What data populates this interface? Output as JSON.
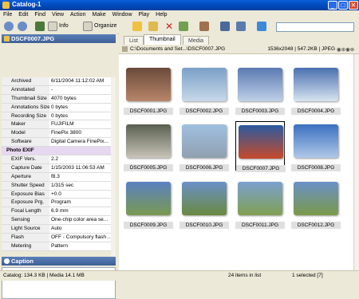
{
  "window": {
    "title": "Catalog-1",
    "min": "_",
    "max": "□",
    "close": "✕"
  },
  "menu": [
    "File",
    "Edit",
    "Find",
    "View",
    "Action",
    "Make",
    "Window",
    "Play",
    "Help"
  ],
  "toolbar": {
    "info_label": "Info",
    "organize_label": "Organize",
    "search_placeholder": ""
  },
  "left": {
    "file_header": "DSCF0007.JPG",
    "properties": [
      {
        "k": "Archived",
        "v": "6/11/2004 11:12:02 AM"
      },
      {
        "k": "Annotated",
        "v": "-"
      },
      {
        "k": "Thumbnail Size",
        "v": "4070 bytes"
      },
      {
        "k": "Annotations Size",
        "v": "0 bytes"
      },
      {
        "k": "Recording Size",
        "v": "0 bytes"
      },
      {
        "k": "Maker",
        "v": "FUJIFILM"
      },
      {
        "k": "Model",
        "v": "FinePix 3800"
      },
      {
        "k": "Software",
        "v": "Digital Camera FinePix..."
      }
    ],
    "exif_header": "Photo EXIF",
    "exif": [
      {
        "k": "EXIF Vers.",
        "v": "2.2"
      },
      {
        "k": "Capture Date",
        "v": "1/15/2003 11:06:53 AM"
      },
      {
        "k": "Aperture",
        "v": "f8.3"
      },
      {
        "k": "Shutter Speed",
        "v": "1/315 sec"
      },
      {
        "k": "Exposure Bias",
        "v": "+0.0"
      },
      {
        "k": "Exposure Prg.",
        "v": "Program"
      },
      {
        "k": "Focal Length",
        "v": "6.9 mm"
      },
      {
        "k": "Sensing",
        "v": "One-chip color area se..."
      },
      {
        "k": "Light Source",
        "v": "Auto"
      },
      {
        "k": "Flash",
        "v": "OFF - Compulsory flash ..."
      },
      {
        "k": "Metering",
        "v": "Pattern"
      }
    ],
    "caption_header": "Caption"
  },
  "right": {
    "tabs": [
      "List",
      "Thumbnail",
      "Media"
    ],
    "active_tab": "Thumbnail",
    "path": "C:\\Documents and Set...\\DSCF0007.JPG",
    "meta": "1536x2048 | 547.2KB | JPEG",
    "thumbnails": [
      {
        "name": "DSCF0001.JPG",
        "c1": "#6a4a3a",
        "c2": "#b8866a"
      },
      {
        "name": "DSCF0002.JPG",
        "c1": "#7aa0c8",
        "c2": "#c8d8e8"
      },
      {
        "name": "DSCF0003.JPG",
        "c1": "#5a7ab0",
        "c2": "#c0d0e8"
      },
      {
        "name": "DSCF0004.JPG",
        "c1": "#4a70b0",
        "c2": "#d8e4f0"
      },
      {
        "name": "DSCF0005.JPG",
        "c1": "#5a6050",
        "c2": "#c8c4b8"
      },
      {
        "name": "DSCF0006.JPG",
        "c1": "#a0c0e0",
        "c2": "#90a0b0"
      },
      {
        "name": "DSCF0007.JPG",
        "c1": "#2a5aa0",
        "c2": "#c84a2a",
        "selected": true
      },
      {
        "name": "DSCF0008.JPG",
        "c1": "#3a70c0",
        "c2": "#b0c8e8"
      },
      {
        "name": "DSCF0009.JPG",
        "c1": "#5a80c0",
        "c2": "#7a9a50"
      },
      {
        "name": "DSCF0010.JPG",
        "c1": "#6a90c8",
        "c2": "#6a8a40"
      },
      {
        "name": "DSCF0011.JPG",
        "c1": "#7aa0d0",
        "c2": "#80a050"
      },
      {
        "name": "DSCF0012.JPG",
        "c1": "#6a90c8",
        "c2": "#7a9a48"
      }
    ]
  },
  "status": {
    "left": "Catalog: 134.3 KB | Media 14.1 MB",
    "items": "24 items in list",
    "selected": "1 selected [7]"
  }
}
